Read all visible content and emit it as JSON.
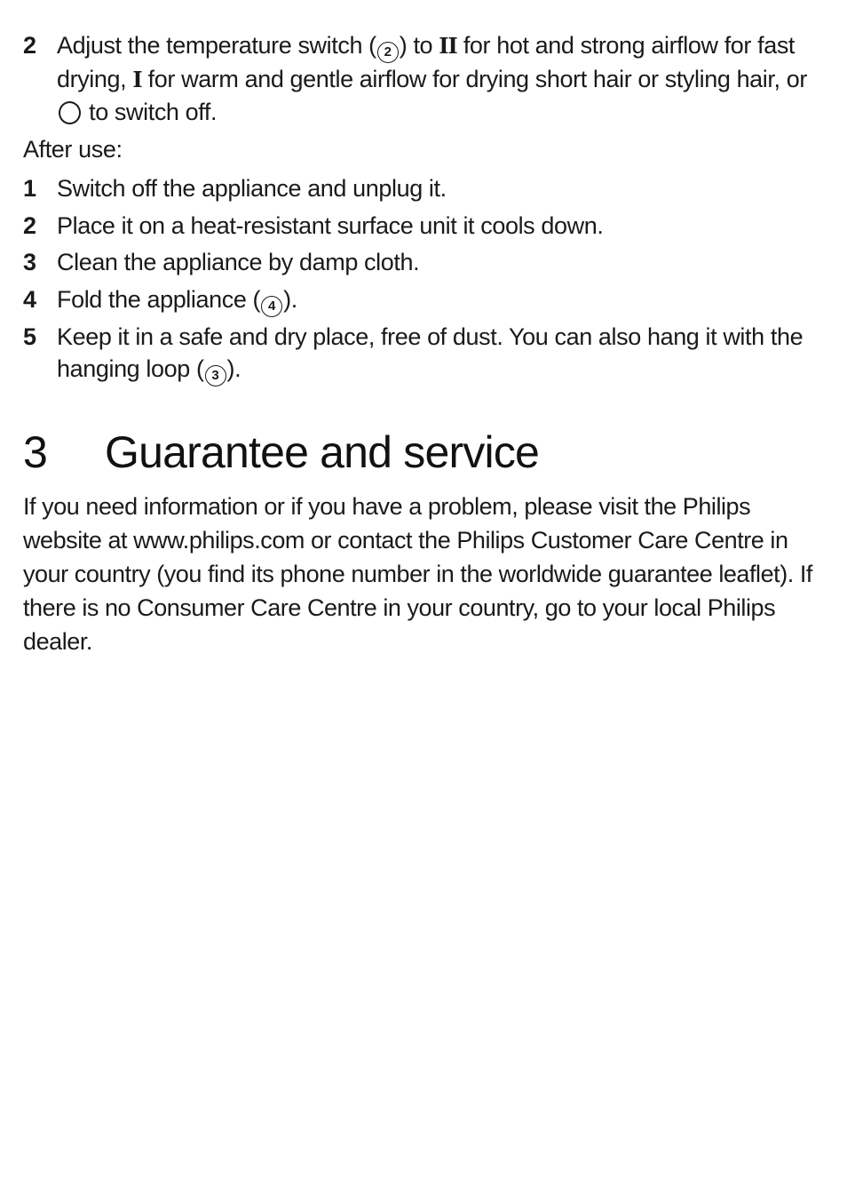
{
  "steps_top": [
    {
      "number": "2",
      "segments": {
        "a": "Adjust the temperature switch (",
        "ref": "2",
        "b": ") to ",
        "hot_symbol": "II",
        "c": " for hot and strong airflow for fast drying, ",
        "warm_symbol": "I",
        "d": " for warm and gentle airflow for drying short hair or styling hair, or ",
        "e": " to switch off."
      },
      "icons": [
        "circled-2-callout",
        "roman-two-setting",
        "roman-one-setting",
        "off-circle-setting"
      ]
    }
  ],
  "after_use": {
    "heading": "After use:",
    "steps": [
      {
        "number": "1",
        "text": "Switch off the appliance and unplug it."
      },
      {
        "number": "2",
        "text": "Place it on a heat-resistant surface unit it cools down."
      },
      {
        "number": "3",
        "text": "Clean the appliance by damp cloth."
      },
      {
        "number": "4",
        "text_a": "Fold the appliance (",
        "ref": "4",
        "text_b": ")."
      },
      {
        "number": "5",
        "text_a": "Keep it in a safe and dry place, free of dust. You can also hang it with the hanging loop (",
        "ref": "3",
        "text_b": ")."
      }
    ]
  },
  "section": {
    "number": "3",
    "title": "Guarantee and service",
    "paragraph": "If you need information or if you have a problem, please visit the Philips website at www.philips.com or contact the Philips Customer Care Centre in your country (you find its phone number in the worldwide guarantee leaflet). If there is no Consumer Care Centre in your country, go to your local Philips dealer."
  }
}
